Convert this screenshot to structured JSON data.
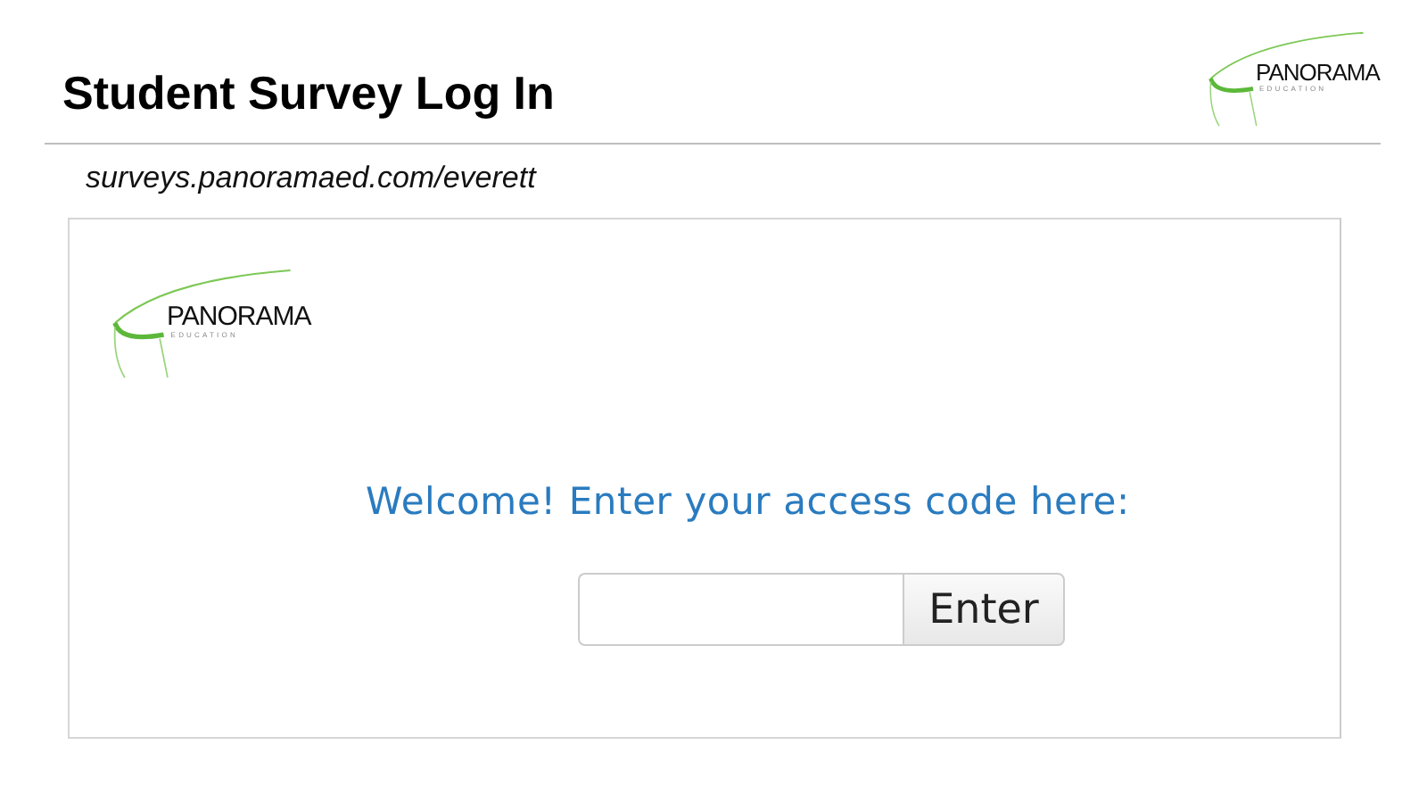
{
  "header": {
    "title": "Student Survey Log In",
    "logo": {
      "name": "PANORAMA",
      "subtitle": "EDUCATION"
    }
  },
  "url": "surveys.panoramaed.com/everett",
  "card": {
    "logo": {
      "name": "PANORAMA",
      "subtitle": "EDUCATION"
    },
    "welcome": "Welcome! Enter your access code here:",
    "button": "Enter"
  }
}
